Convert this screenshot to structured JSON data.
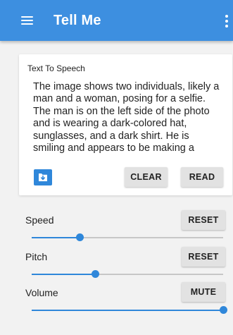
{
  "app": {
    "title": "Tell Me",
    "accent_color": "#3d8fe0",
    "menu_icon": "hamburger-menu-icon",
    "overflow_icon": "more-vertical-icon"
  },
  "tts_card": {
    "label": "Text To Speech",
    "text": "The image shows two individuals, likely a man and a woman, posing for a selfie. The man is on the left side of the photo and is wearing a dark-colored hat, sunglasses, and a dark shirt. He is smiling and appears to be making a",
    "save_icon": "download-folder-icon",
    "clear_label": "CLEAR",
    "read_label": "READ"
  },
  "controls": {
    "speed": {
      "label": "Speed",
      "button_label": "RESET",
      "value": 0.25
    },
    "pitch": {
      "label": "Pitch",
      "button_label": "RESET",
      "value": 0.33
    },
    "volume": {
      "label": "Volume",
      "button_label": "MUTE",
      "value": 1.0
    }
  }
}
